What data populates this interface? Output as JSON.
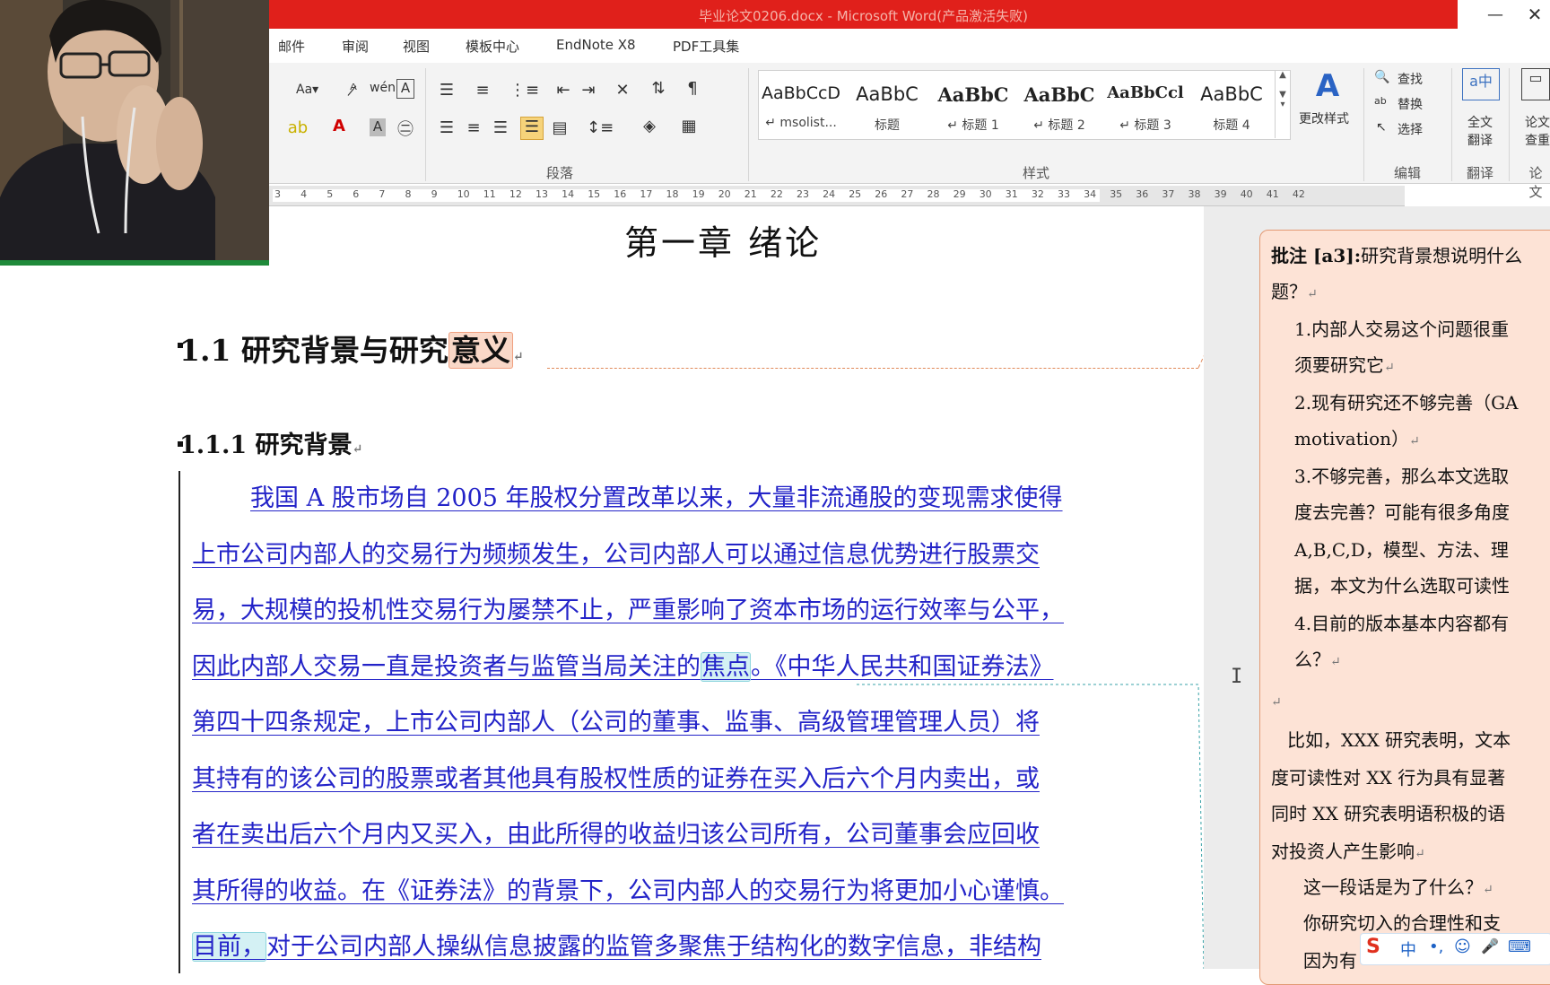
{
  "window": {
    "title": "毕业论文0206.docx - Microsoft Word(产品激活失败)",
    "minimize_glyph": "—",
    "close_glyph": "✕"
  },
  "menu": {
    "items": [
      "邮件",
      "审阅",
      "视图",
      "模板中心",
      "EndNote X8",
      "PDF工具集"
    ]
  },
  "ribbon": {
    "font_size_label": "Aa▾",
    "groups": {
      "paragraph": "段落",
      "styles": "样式",
      "editing": "编辑",
      "translate": "翻译",
      "thesis": "论文"
    },
    "styles": [
      {
        "sample": "AaBbCcD",
        "name": "↵ msolist..."
      },
      {
        "sample": "AaBbC",
        "name": "标题"
      },
      {
        "sample": "AaBbC",
        "name": "↵ 标题 1"
      },
      {
        "sample": "AaBbC",
        "name": "↵ 标题 2"
      },
      {
        "sample": "AaBbCcl",
        "name": "↵ 标题 3"
      },
      {
        "sample": "AaBbC",
        "name": "标题 4"
      }
    ],
    "change_styles": "更改样式",
    "find": "查找",
    "replace": "替换",
    "select": "选择",
    "full_translate_1": "全文",
    "full_translate_2": "翻译",
    "thesis_check_1": "论文",
    "thesis_check_2": "查重",
    "icons": [
      "change-case-icon",
      "clear-format-icon",
      "phonetic-guide-icon",
      "char-border-icon",
      "bullets-icon",
      "numbering-icon",
      "multilevel-list-icon",
      "decrease-indent-icon",
      "increase-indent-icon",
      "chinese-layout-icon",
      "sort-icon",
      "show-marks-icon",
      "highlight-icon",
      "font-color-icon",
      "char-shading-icon",
      "enclose-char-icon",
      "align-left-icon",
      "align-center-icon",
      "align-right-icon",
      "justify-icon",
      "distributed-icon",
      "line-spacing-icon",
      "shading-icon",
      "borders-icon"
    ]
  },
  "ruler": {
    "ticks": [
      "3",
      "4",
      "5",
      "6",
      "7",
      "8",
      "9",
      "10",
      "11",
      "12",
      "13",
      "14",
      "15",
      "16",
      "17",
      "18",
      "19",
      "20",
      "21",
      "22",
      "23",
      "24",
      "25",
      "26",
      "27",
      "28",
      "29",
      "30",
      "31",
      "32",
      "33",
      "34",
      "35",
      "36",
      "37",
      "38",
      "39",
      "40",
      "41",
      "42"
    ]
  },
  "document": {
    "chapter_title": "第一章  绪论",
    "heading_1_prefix": "1.1 研究背景与研究",
    "heading_1_highlight": "意义",
    "heading_2": "1.1.1 研究背景",
    "paragraph_lines": [
      "我国 A 股市场自 2005 年股权分置改革以来，大量非流通股的变现需求使得",
      "上市公司内部人的交易行为频频发生，公司内部人可以通过信息优势进行股票交",
      "易，大规模的投机性交易行为屡禁不止，严重影响了资本市场的运行效率与公平，",
      "因此内部人交易一直是投资者与监管当局关注的",
      "第四十四条规定，上市公司内部人（公司的董事、监事、高级管理管理人员）将",
      "其持有的该公司的股票或者其他具有股权性质的证券在买入后六个月内卖出，或",
      "者在卖出后六个月内又买入，由此所得的收益归该公司所有，公司董事会应回收",
      "其所得的收益。在《证券法》的背景下，公司内部人的交易行为将更加小心谨慎。",
      "对于公司内部人操纵信息披露的监管多聚焦于结构化的数字信息，非结构"
    ],
    "line4_highlight": "焦点",
    "line4_tail": "。《中华人民共和国证券法》",
    "line9_highlight": "目前，"
  },
  "comment": {
    "label": "批注 [a3]:",
    "lines": [
      "研究背景想说明什么",
      "题？",
      "1.内部人交易这个问题很重",
      "须要研究它",
      "2.现有研究还不够完善（GA",
      "motivation）",
      "3.不够完善，那么本文选取",
      "度去完善？可能有很多角度",
      "A,B,C,D，模型、方法、理",
      "据，本文为什么选取可读性",
      "4.目前的版本基本内容都有",
      "么？",
      "比如，XXX 研究表明，文本",
      "度可读性对 XX 行为具有显著",
      "同时 XX 研究表明语积极的语",
      "对投资人产生影响",
      "这一段话是为了什么？",
      "你研究切入的合理性和支",
      "因为有"
    ]
  },
  "ime": {
    "items": [
      "S",
      "中",
      "•,",
      "☺",
      "🎤",
      "⌨"
    ]
  },
  "colors": {
    "title_red": "#e0201b",
    "link_blue": "#2323c8",
    "comment_bg": "#fde3d6",
    "highlight_orange": "#f9d8c8",
    "highlight_cyan": "#d4f1f4"
  }
}
